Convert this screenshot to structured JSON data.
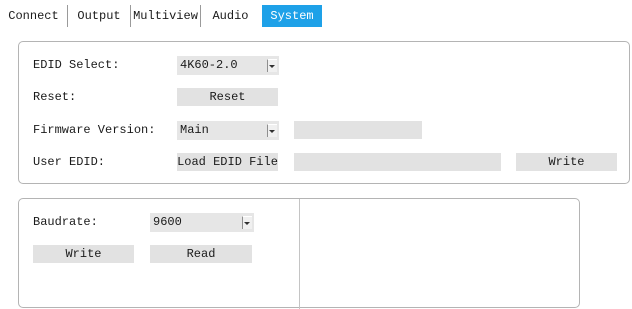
{
  "tabs": [
    {
      "label": "Connect"
    },
    {
      "label": "Output"
    },
    {
      "label": "Multiview"
    },
    {
      "label": "Audio"
    },
    {
      "label": "System",
      "active": true
    }
  ],
  "edid_panel": {
    "edid_select_label": "EDID Select:",
    "edid_select_value": "4K60-2.0",
    "reset_label": "Reset:",
    "reset_button": "Reset",
    "firmware_label": "Firmware Version:",
    "firmware_value": "Main",
    "firmware_field_value": "",
    "user_edid_label": "User EDID:",
    "load_button": "Load EDID File",
    "user_edid_field_value": "",
    "write_button": "Write"
  },
  "serial_panel": {
    "baudrate_label": "Baudrate:",
    "baudrate_value": "9600",
    "write_button": "Write",
    "read_button": "Read"
  },
  "colors": {
    "active_tab": "#1ea1e8",
    "control_bg": "#e2e2e2",
    "panel_border": "#b4b4b4"
  }
}
